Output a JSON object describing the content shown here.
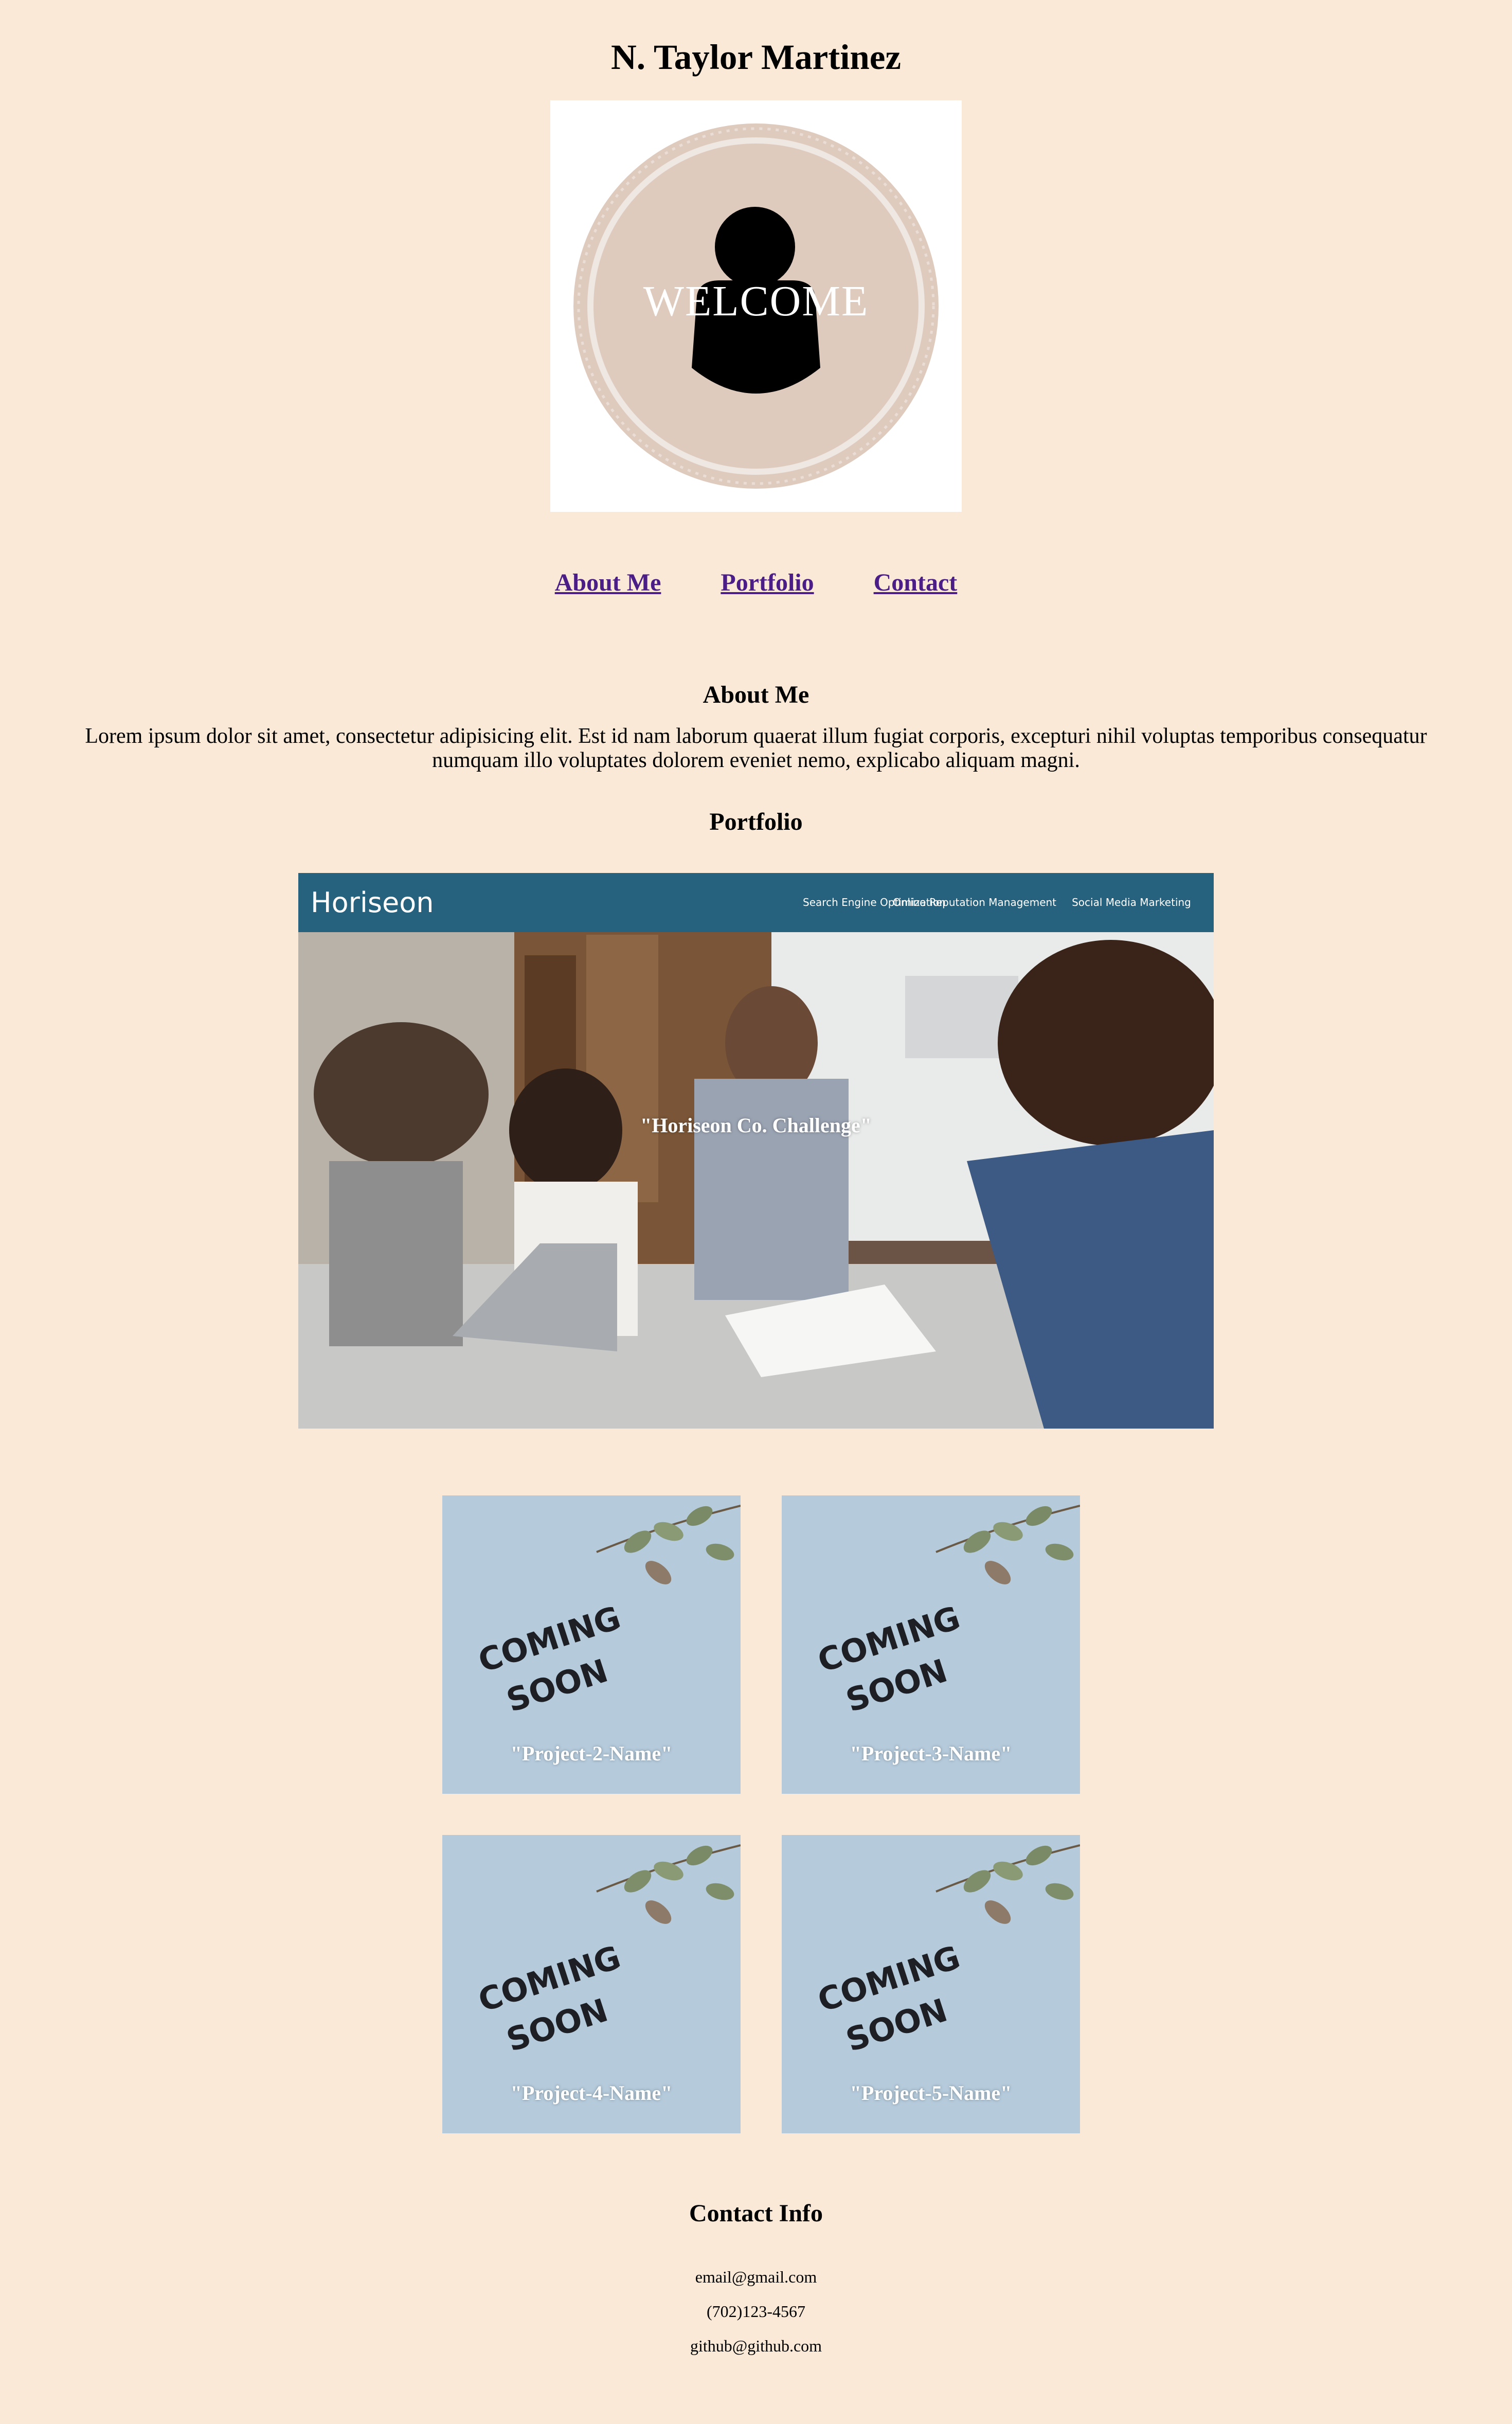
{
  "header": {
    "title": "N. Taylor Martinez",
    "avatar_text": "WELCOME"
  },
  "nav": {
    "items": [
      "About Me",
      "Portfolio",
      "Contact"
    ]
  },
  "about": {
    "heading": "About Me",
    "text": "Lorem ipsum dolor sit amet, consectetur adipisicing elit. Est id nam laborum quaerat illum fugiat corporis, excepturi nihil voluptas temporibus consequatur numquam illo voluptates dolorem eveniet nemo, explicabo aliquam magni."
  },
  "portfolio": {
    "heading": "Portfolio",
    "featured": {
      "label": "\"Horiseon Co. Challenge\"",
      "brand": "Horiseon",
      "nav": [
        "Search Engine Optimization",
        "Online Reputation Management",
        "Social Media Marketing"
      ]
    },
    "projects": [
      {
        "label": "\"Project-2-Name\"",
        "image_text_1": "COMING",
        "image_text_2": "SOON"
      },
      {
        "label": "\"Project-3-Name\"",
        "image_text_1": "COMING",
        "image_text_2": "SOON"
      },
      {
        "label": "\"Project-4-Name\"",
        "image_text_1": "COMING",
        "image_text_2": "SOON"
      },
      {
        "label": "\"Project-5-Name\"",
        "image_text_1": "COMING",
        "image_text_2": "SOON"
      }
    ]
  },
  "contact": {
    "heading": "Contact Info",
    "email": "email@gmail.com",
    "phone": "(702)123-4567",
    "github": "github@github.com"
  },
  "colors": {
    "background": "#fae9d6",
    "link": "#4b1d86",
    "horiseon_header": "#26627e"
  }
}
